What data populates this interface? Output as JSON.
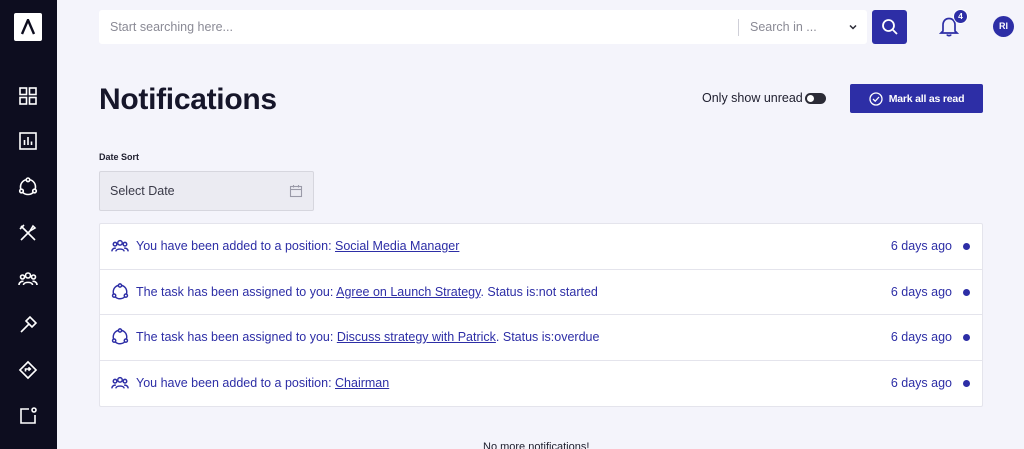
{
  "search": {
    "placeholder": "Start searching here...",
    "scope_label": "Search in ..."
  },
  "header": {
    "notification_count": "4",
    "avatar_initials": "RI"
  },
  "sidebar": {
    "items": [
      {
        "icon": "dashboard-grid-icon"
      },
      {
        "icon": "bar-chart-icon"
      },
      {
        "icon": "task-cycle-icon"
      },
      {
        "icon": "tools-icon"
      },
      {
        "icon": "people-group-icon"
      },
      {
        "icon": "hammer-icon"
      },
      {
        "icon": "direction-sign-icon"
      },
      {
        "icon": "notification-square-icon"
      }
    ]
  },
  "page": {
    "title": "Notifications",
    "only_unread_label": "Only show unread",
    "only_unread_on": false,
    "mark_all_label": "Mark all as read"
  },
  "filter": {
    "date_sort_label": "Date Sort",
    "date_placeholder": "Select Date"
  },
  "notifications": [
    {
      "icon": "people-group-icon",
      "prefix": "You have been added to a position: ",
      "link": "Social Media Manager",
      "suffix": "",
      "time": "6 days ago",
      "unread": true
    },
    {
      "icon": "task-cycle-icon",
      "prefix": "The task has been assigned to you: ",
      "link": "Agree on Launch Strategy",
      "suffix": ". Status is:not started",
      "time": "6 days ago",
      "unread": true
    },
    {
      "icon": "task-cycle-icon",
      "prefix": "The task has been assigned to you: ",
      "link": "Discuss strategy with Patrick",
      "suffix": ". Status is:overdue",
      "time": "6 days ago",
      "unread": true
    },
    {
      "icon": "people-group-icon",
      "prefix": "You have been added to a position: ",
      "link": "Chairman",
      "suffix": "",
      "time": "6 days ago",
      "unread": true
    }
  ],
  "footer": {
    "end_message": "No more notifications!"
  },
  "colors": {
    "accent": "#2d2ea6",
    "sidebar_bg": "#0d0d1f",
    "page_bg": "#f4f4fb"
  }
}
